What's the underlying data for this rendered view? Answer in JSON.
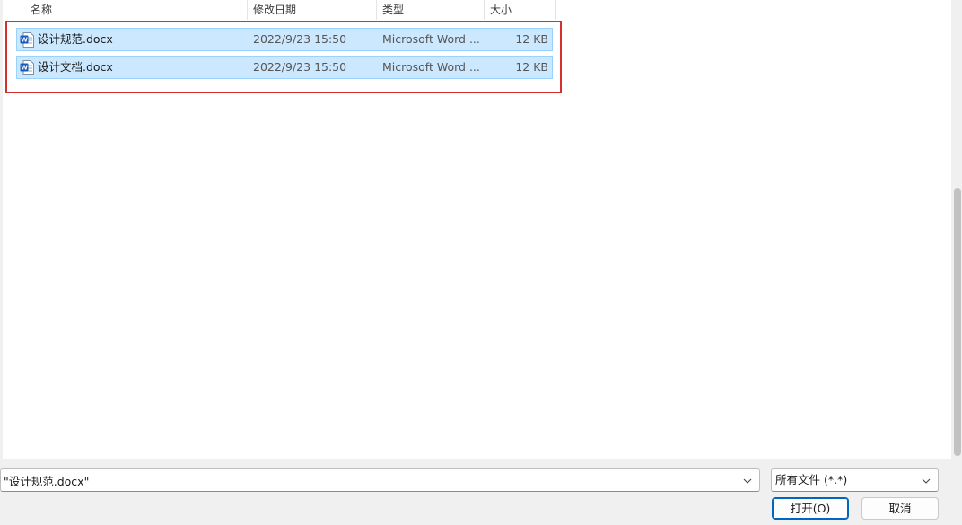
{
  "columns": [
    {
      "label": "名称"
    },
    {
      "label": "修改日期"
    },
    {
      "label": "类型"
    },
    {
      "label": "大小"
    }
  ],
  "files": [
    {
      "name": "设计规范.docx",
      "date": "2022/9/23 15:50",
      "type": "Microsoft Word ...",
      "size": "12 KB",
      "icon": "word-doc-icon"
    },
    {
      "name": "设计文档.docx",
      "date": "2022/9/23 15:50",
      "type": "Microsoft Word ...",
      "size": "12 KB",
      "icon": "word-doc-icon"
    }
  ],
  "footer": {
    "filename_value": "\"设计规范.docx\"",
    "filter_label": "所有文件 (*.*)",
    "open_label": "打开(O)",
    "cancel_label": "取消"
  },
  "colors": {
    "selection_bg": "#cce8ff",
    "selection_border": "#99d1ff",
    "highlight_border": "#d62f2f",
    "primary_border": "#0067c0",
    "word_blue": "#185abd"
  }
}
